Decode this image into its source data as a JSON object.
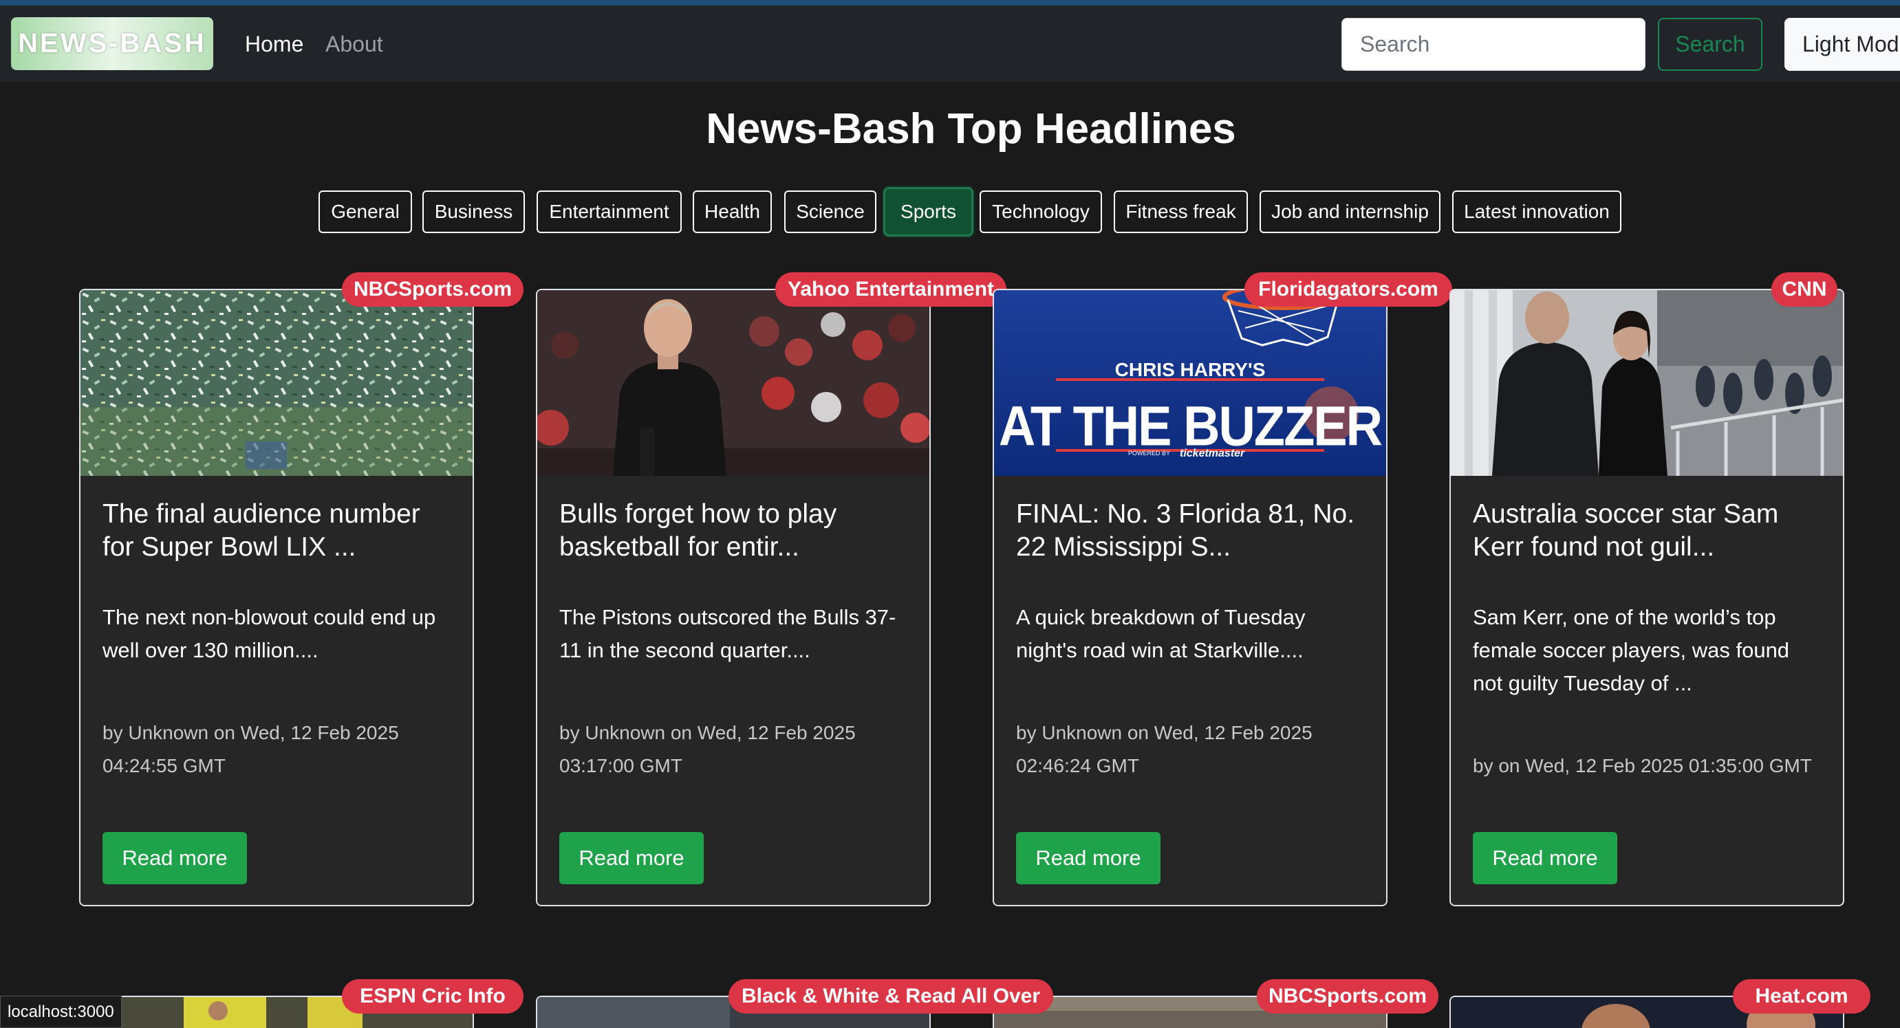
{
  "nav": {
    "brand": "NEWS-BASH",
    "home": "Home",
    "about": "About",
    "search_placeholder": "Search",
    "search_button": "Search",
    "mode_button": "Light Mod"
  },
  "page_title": "News-Bash Top Headlines",
  "categories": [
    {
      "label": "General",
      "active": false
    },
    {
      "label": "Business",
      "active": false
    },
    {
      "label": "Entertainment",
      "active": false
    },
    {
      "label": "Health",
      "active": false
    },
    {
      "label": "Science",
      "active": false
    },
    {
      "label": "Sports",
      "active": true
    },
    {
      "label": "Technology",
      "active": false
    },
    {
      "label": "Fitness freak",
      "active": false
    },
    {
      "label": "Job and internship",
      "active": false
    },
    {
      "label": "Latest innovation",
      "active": false
    }
  ],
  "articles": [
    {
      "source": "NBCSports.com",
      "title": "The final audience number for Super Bowl LIX ...",
      "description": "The next non-blowout could end up well over 130 million....",
      "meta": "by Unknown on Wed, 12 Feb 2025 04:24:55 GMT",
      "read_more": "Read more"
    },
    {
      "source": "Yahoo Entertainment",
      "title": "Bulls forget how to play basketball for entir...",
      "description": "The Pistons outscored the Bulls 37-11 in the second quarter....",
      "meta": "by Unknown on Wed, 12 Feb 2025 03:17:00 GMT",
      "read_more": "Read more"
    },
    {
      "source": "Floridagators.com",
      "title": "FINAL: No. 3 Florida 81, No. 22 Mississippi S...",
      "description": "A quick breakdown of Tuesday night's road win at Starkville....",
      "meta": "by Unknown on Wed, 12 Feb 2025 02:46:24 GMT",
      "read_more": "Read more",
      "image_text": {
        "top": "CHRIS HARRY'S",
        "main": "AT THE BUZZER",
        "powered": "POWERED BY",
        "brand": "ticketmaster"
      }
    },
    {
      "source": "CNN",
      "title": "Australia soccer star Sam Kerr found not guil...",
      "description": "Sam Kerr, one of the world’s top female soccer players, was found not guilty Tuesday of ...",
      "meta": "by on Wed, 12 Feb 2025 01:35:00 GMT",
      "read_more": "Read more"
    }
  ],
  "second_row_sources": [
    "ESPN Cric Info",
    "Black & White & Read All Over",
    "NBCSports.com",
    "Heat.com"
  ],
  "status_bar": "localhost:3000",
  "colors": {
    "background": "#1a1a1a",
    "navbar": "#212529",
    "badge": "#dc3545",
    "read_more": "#1fa34a",
    "active_category": "#0f5132"
  }
}
